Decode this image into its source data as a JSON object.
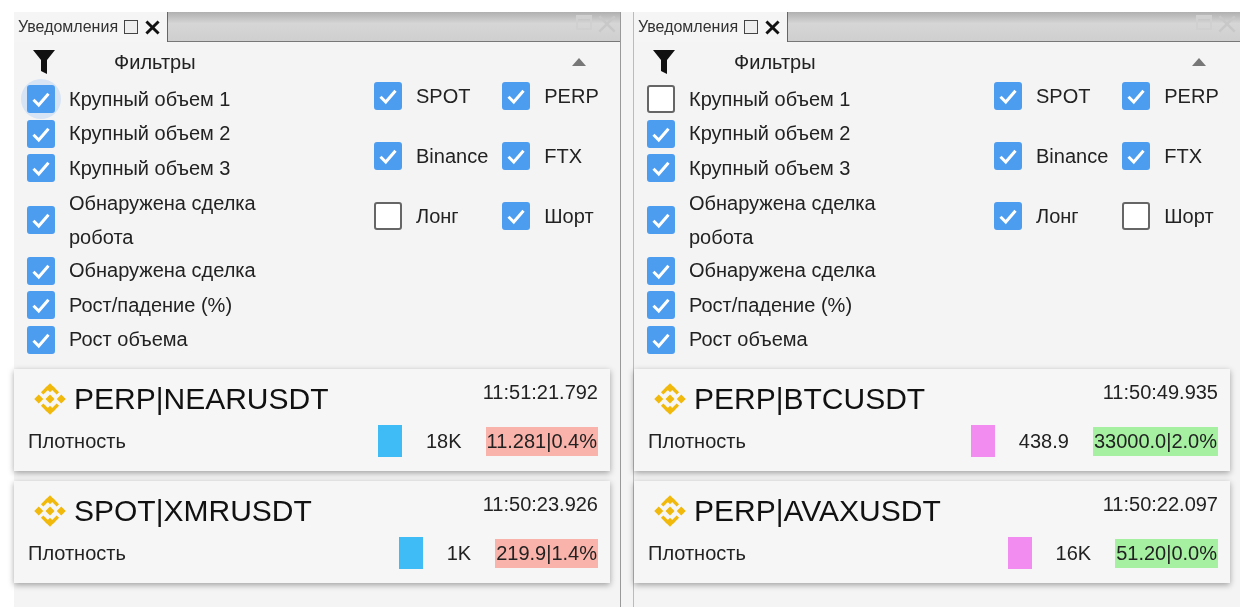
{
  "panels": [
    {
      "tab": {
        "title": "Уведомления"
      },
      "filter_title": "Фильтры",
      "expanded": true,
      "filters": [
        {
          "label": "Крупный объем 1",
          "checked": true,
          "focused": true
        },
        {
          "label": "Крупный объем 2",
          "checked": true,
          "focused": false
        },
        {
          "label": "Крупный объем 3",
          "checked": true,
          "focused": false
        },
        {
          "label": "Обнаружена сделка робота",
          "checked": true,
          "focused": false
        },
        {
          "label": "Обнаружена сделка",
          "checked": true,
          "focused": false
        },
        {
          "label": "Рост/падение (%)",
          "checked": true,
          "focused": false
        },
        {
          "label": "Рост объема",
          "checked": true,
          "focused": false
        }
      ],
      "options": [
        {
          "label": "SPOT",
          "checked": true
        },
        {
          "label": "PERP",
          "checked": true
        },
        {
          "label": "Binance",
          "checked": true
        },
        {
          "label": "FTX",
          "checked": true
        },
        {
          "label": "Лонг",
          "checked": false
        },
        {
          "label": "Шорт",
          "checked": true
        }
      ],
      "alerts": [
        {
          "symbol": "PERP|NEARUSDT",
          "time": "11:51:21.792",
          "type": "Плотность",
          "color": "#3fbcf5",
          "volume": "18K",
          "price": {
            "text": "11.281|0.4%",
            "color": "#f9b3aa"
          }
        },
        {
          "symbol": "SPOT|XMRUSDT",
          "time": "11:50:23.926",
          "type": "Плотность",
          "color": "#3fbcf5",
          "volume": "1K",
          "price": {
            "text": "219.9|1.4%",
            "color": "#f9b3aa"
          }
        }
      ]
    },
    {
      "tab": {
        "title": "Уведомления"
      },
      "filter_title": "Фильтры",
      "expanded": true,
      "filters": [
        {
          "label": "Крупный объем 1",
          "checked": false,
          "focused": false
        },
        {
          "label": "Крупный объем 2",
          "checked": true,
          "focused": false
        },
        {
          "label": "Крупный объем 3",
          "checked": true,
          "focused": false
        },
        {
          "label": "Обнаружена сделка робота",
          "checked": true,
          "focused": false
        },
        {
          "label": "Обнаружена сделка",
          "checked": true,
          "focused": false
        },
        {
          "label": "Рост/падение (%)",
          "checked": true,
          "focused": false
        },
        {
          "label": "Рост объема",
          "checked": true,
          "focused": false
        }
      ],
      "options": [
        {
          "label": "SPOT",
          "checked": true
        },
        {
          "label": "PERP",
          "checked": true
        },
        {
          "label": "Binance",
          "checked": true
        },
        {
          "label": "FTX",
          "checked": true
        },
        {
          "label": "Лонг",
          "checked": true
        },
        {
          "label": "Шорт",
          "checked": false
        }
      ],
      "alerts": [
        {
          "symbol": "PERP|BTCUSDT",
          "time": "11:50:49.935",
          "type": "Плотность",
          "color": "#f28cf0",
          "volume": "438.9",
          "price": {
            "text": "33000.0|2.0%",
            "color": "#a6f0a2"
          }
        },
        {
          "symbol": "PERP|AVAXUSDT",
          "time": "11:50:22.097",
          "type": "Плотность",
          "color": "#f28cf0",
          "volume": "16K",
          "price": {
            "text": "51.20|0.0%",
            "color": "#a6f0a2"
          }
        }
      ]
    }
  ]
}
